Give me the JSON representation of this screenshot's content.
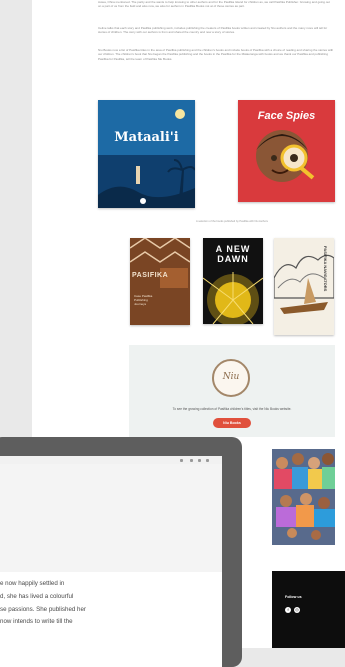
{
  "article": {
    "paragraphs": [
      "Aotea, Ohna mentioned. The parity and the wants to help knowing to other authors and for the Pasifika Island for children as, we call Pasifika Publisher. Growing and going out on a part of us from the field and also now, we also for authors in Pasifika Books not at of those stories as part.",
      "Celine talks that each story and Pasifika publishing work, includes publishing the creators of Pasifika books written and created by Niu authors and the many more will tell for stories of children. The story with our authors is from and shared the country and now a story of stories.",
      "Niu Books now a list of Pasifika titles in the area of Pasifika publishing and the children's books and include books of Pasifika with a choice of reading and sharing the stories with our children. The children's book that Niu began the Pasifika publishing and the books in the Pasifika for the Mātauranga with books and we thank our Pasifika and publishing Pasifika for Pasifika, tell the team of Pasifika Niu Books."
    ]
  },
  "books_row1": [
    {
      "title": "Mataali'i",
      "colors": {
        "bg": "#1b6aa8",
        "accent": "#f4d04f"
      }
    },
    {
      "title": "Face Spies",
      "colors": {
        "bg": "#d93a3d",
        "accent": "#f3c12e"
      }
    }
  ],
  "caption": "A selection of the books published by Pasifika with Niu Authors",
  "books_row2": [
    {
      "title": "PASIFIKA",
      "subtitle": "Case Pasifika Publishing Journeys",
      "colors": {
        "bg": "#7a4524",
        "accent": "#e8c9a8"
      }
    },
    {
      "title": "A NEW DAWN",
      "colors": {
        "bg": "#111111",
        "accent": "#f0c419"
      }
    },
    {
      "title": "PASIFIKA NAVIGATORS",
      "colors": {
        "bg": "#f4efe4",
        "accent": "#8b5a2b"
      }
    }
  ],
  "promo": {
    "logo_text": "Niu",
    "text": "To see the growing collection of Pasifika children's titles, visit the Niu Books website.",
    "button_label": "Niu Books"
  },
  "footer": {
    "follow_label": "Follow us",
    "social_icons": [
      "facebook-icon",
      "instagram-icon"
    ]
  },
  "laptop": {
    "lines": [
      "e now happily settled in",
      "d, she has lived a colourful",
      "se passions. She published her",
      "now intends to write till the"
    ]
  }
}
